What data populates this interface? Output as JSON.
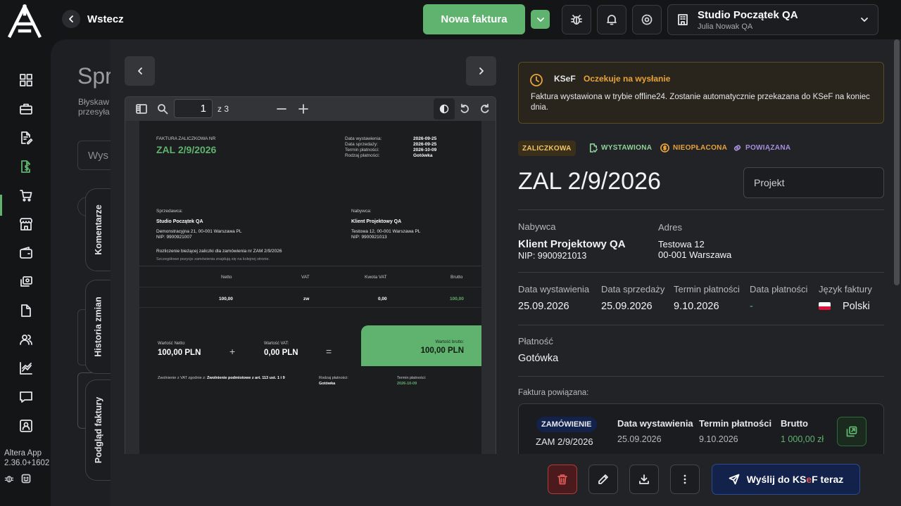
{
  "topbar": {
    "back_label": "Wstecz",
    "new_invoice_label": "Nowa faktura",
    "company_name": "Studio Początek QA",
    "company_user": "Julia Nowak QA"
  },
  "sidebar": {
    "app_name": "Altera App",
    "version": "2.36.0+1602"
  },
  "background_page": {
    "title": "Spr",
    "subtitle_line1": "Błyskaw",
    "subtitle_line2": "przesyła",
    "search_placeholder": "Wys",
    "tabs": [
      "Komentarze",
      "Historia zmian",
      "Podgląd faktury"
    ]
  },
  "viewer": {
    "page_current": "1",
    "page_total": "z 3",
    "doc": {
      "doc_type": "FAKTURA ZALICZKOWA NR",
      "number": "ZAL 2/9/2026",
      "meta_labels": [
        "Data wystawienia:",
        "Data sprzedaży:",
        "Termin płatności:",
        "Rodzaj płatności:"
      ],
      "meta_values": [
        "2026-09-25",
        "2026-09-25",
        "2026-10-09",
        "Gotówka"
      ],
      "seller_label": "Sprzedawca:",
      "seller_name": "Studio Początek QA",
      "seller_address": "Demonstracyjna 21, 00-001 Warszawa PL",
      "seller_nip": "NIP: 9900921007",
      "buyer_label": "Nabywca:",
      "buyer_name": "Klient Projektowy QA",
      "buyer_address": "Testowa 12, 00-001 Warszawa PL",
      "buyer_nip": "NIP: 9900921013",
      "note1": "Rozliczenie bieżącej zaliczki dla zamówienia nr ZAM 2/9/2026",
      "note2": "Szczegółowe pozycje zamówienia znajdują się na kolejnej stronie.",
      "table_headers": [
        "Netto",
        "VAT",
        "Kwota VAT",
        "Brutto"
      ],
      "table_values": [
        "100,00",
        "zw",
        "0,00",
        "100,00"
      ],
      "net_label": "Wartość Netto:",
      "net_value": "100,00 PLN",
      "plus": "+",
      "vat_label": "Wartość VAT:",
      "vat_value": "0,00 PLN",
      "equals": "=",
      "gross_label": "Wartość brutto:",
      "gross_value": "100,00 PLN",
      "exemption_prefix": "Zwolnienie z VAT zgodnie z:",
      "exemption_text": "Zwolnienie podmiotowe z art. 113 ust. 1 i 9",
      "payment_method_label": "Rodzaj płatności:",
      "payment_method_value": "Gotówka",
      "due_label": "Termin płatności:",
      "due_value": "2026-10-09"
    }
  },
  "ksef_alert": {
    "title": "KSeF",
    "status": "Oczekuje na wysłanie",
    "message": "Faktura wystawiona w trybie offline24. Zostanie automatycznie przekazana do KSeF na koniec dnia."
  },
  "badges": {
    "type": "ZALICZKOWA",
    "issued": "WYSTAWIONA",
    "unpaid": "NIEOPŁACONA",
    "linked": "POWIĄZANA"
  },
  "invoice": {
    "number": "ZAL 2/9/2026",
    "project_placeholder": "Projekt",
    "buyer_label": "Nabywca",
    "buyer_name": "Klient Projektowy QA",
    "buyer_nip": "NIP: 9900921013",
    "address_label": "Adres",
    "address_line1": "Testowa 12",
    "address_line2": "00-001 Warszawa",
    "issue_date_label": "Data wystawienia",
    "issue_date": "25.09.2026",
    "sale_date_label": "Data sprzedaży",
    "sale_date": "25.09.2026",
    "due_date_label": "Termin płatności",
    "due_date": "9.10.2026",
    "payment_date_label": "Data płatności",
    "payment_date": "-",
    "language_label": "Język faktury",
    "language": "Polski",
    "payment_label": "Płatność",
    "payment": "Gotówka"
  },
  "related": {
    "section_label": "Faktura powiązana:",
    "badge": "ZAMÓWIENIE",
    "number": "ZAM 2/9/2026",
    "issue_date_label": "Data wystawienia",
    "issue_date": "25.09.2026",
    "due_date_label": "Termin płatności",
    "due_date": "9.10.2026",
    "gross_label": "Brutto",
    "gross": "1 000,00 zł"
  },
  "actions": {
    "send_prefix": "Wyślij do KS",
    "send_e": "e",
    "send_suffix": "F teraz"
  },
  "colors": {
    "accent_green": "#5fb36f",
    "warning_orange": "#e8a33a",
    "danger_red": "#e05a5a",
    "navy_button": "#13224a"
  }
}
